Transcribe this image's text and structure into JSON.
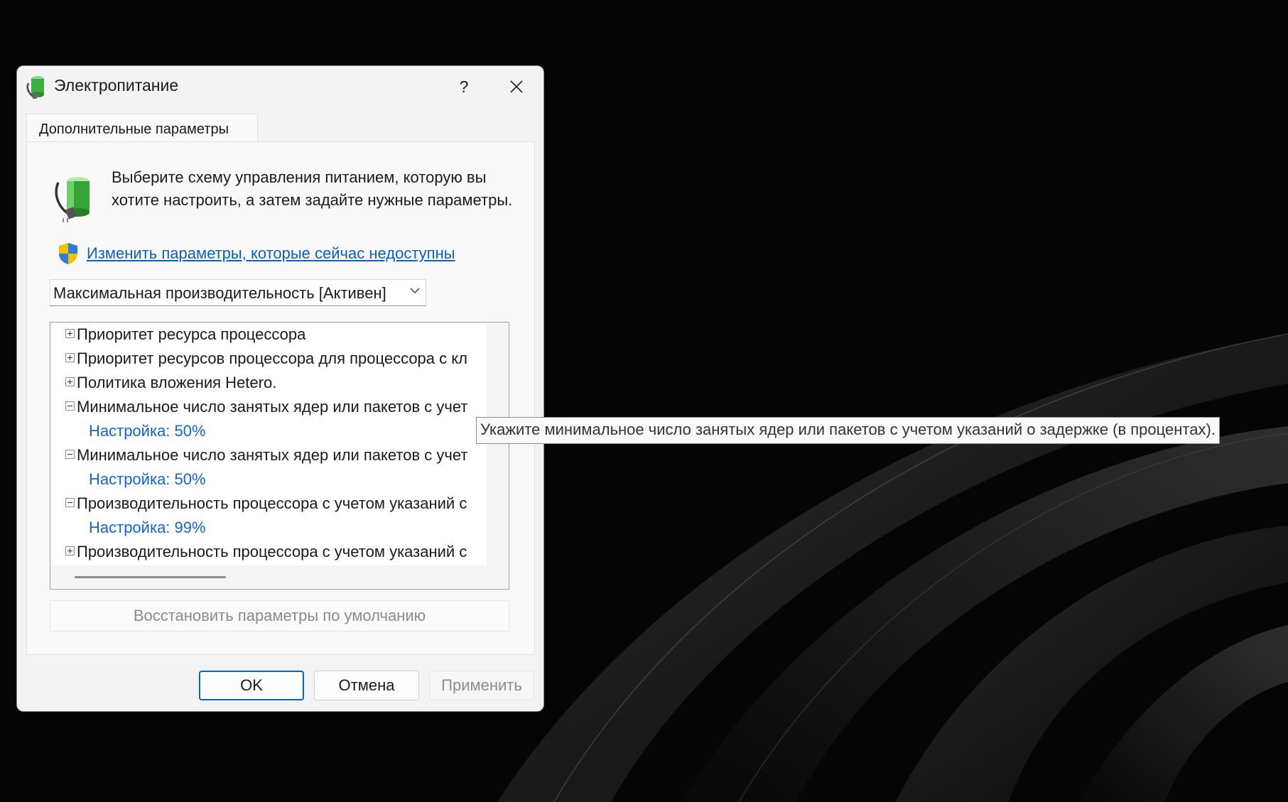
{
  "window": {
    "title": "Электропитание",
    "help_label": "?"
  },
  "tab": {
    "label": "Дополнительные параметры"
  },
  "description": "Выберите схему управления питанием, которую вы хотите настроить, а затем задайте нужные параметры.",
  "elevate_link": "Изменить параметры, которые сейчас недоступны",
  "plan_select": {
    "value": "Максимальная производительность [Активен]"
  },
  "tree": {
    "rows": [
      {
        "label": "Приоритет ресурса процессора",
        "state": "collapsed"
      },
      {
        "label": "Приоритет ресурсов процессора для процессора с кл",
        "state": "collapsed"
      },
      {
        "label": "Политика вложения Hetero.",
        "state": "collapsed"
      },
      {
        "label": "Минимальное число занятых ядер или пакетов с учет",
        "state": "expanded",
        "setting": "Настройка: 50%"
      },
      {
        "label": "Минимальное число занятых ядер или пакетов с учет",
        "state": "expanded",
        "setting": "Настройка: 50%"
      },
      {
        "label": "Производительность процессора с учетом указаний с",
        "state": "expanded",
        "setting": "Настройка: 99%"
      },
      {
        "label": "Производительность процессора с учетом указаний с",
        "state": "collapsed"
      }
    ]
  },
  "restore_label": "Восстановить параметры по умолчанию",
  "buttons": {
    "ok": "OK",
    "cancel": "Отмена",
    "apply": "Применить"
  },
  "tooltip": "Укажите минимальное число занятых ядер или пакетов с учетом указаний о задержке (в процентах).",
  "colors": {
    "accent": "#0067c0",
    "link": "#0b5fb8",
    "setting_value": "#1565c0",
    "background": "#050505"
  },
  "icons": {
    "title": "power-plug-battery-icon",
    "close": "close-icon",
    "battery": "battery-plug-icon",
    "shield": "uac-shield-icon",
    "dropdown": "chevron-down-icon",
    "expand": "plus-box-icon",
    "collapse": "minus-box-icon"
  }
}
